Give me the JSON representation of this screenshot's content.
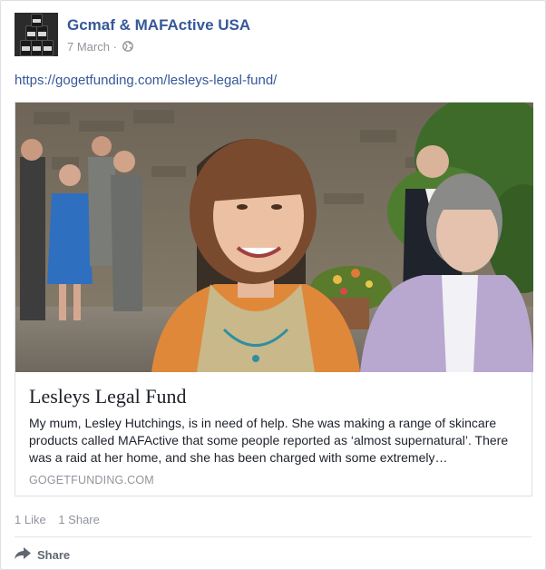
{
  "post": {
    "page_name": "Gcmaf & MAFActive USA",
    "date": "7 March",
    "separator": "·",
    "link_text": "https://gogetfunding.com/lesleys-legal-fund/"
  },
  "attachment": {
    "title": "Lesleys Legal Fund",
    "description": "My mum, Lesley Hutchings, is in need of help. She was making a range of skincare products called MAFActive that some people reported as ‘almost supernatural’. There was a raid at her home, and she has been charged with some extremely…",
    "domain": "GOGETFUNDING.COM"
  },
  "engagement": {
    "likes": "1 Like",
    "shares": "1 Share"
  },
  "actions": {
    "share_label": "Share"
  },
  "colors": {
    "link": "#365899",
    "meta": "#90949c",
    "text": "#1d2129"
  }
}
